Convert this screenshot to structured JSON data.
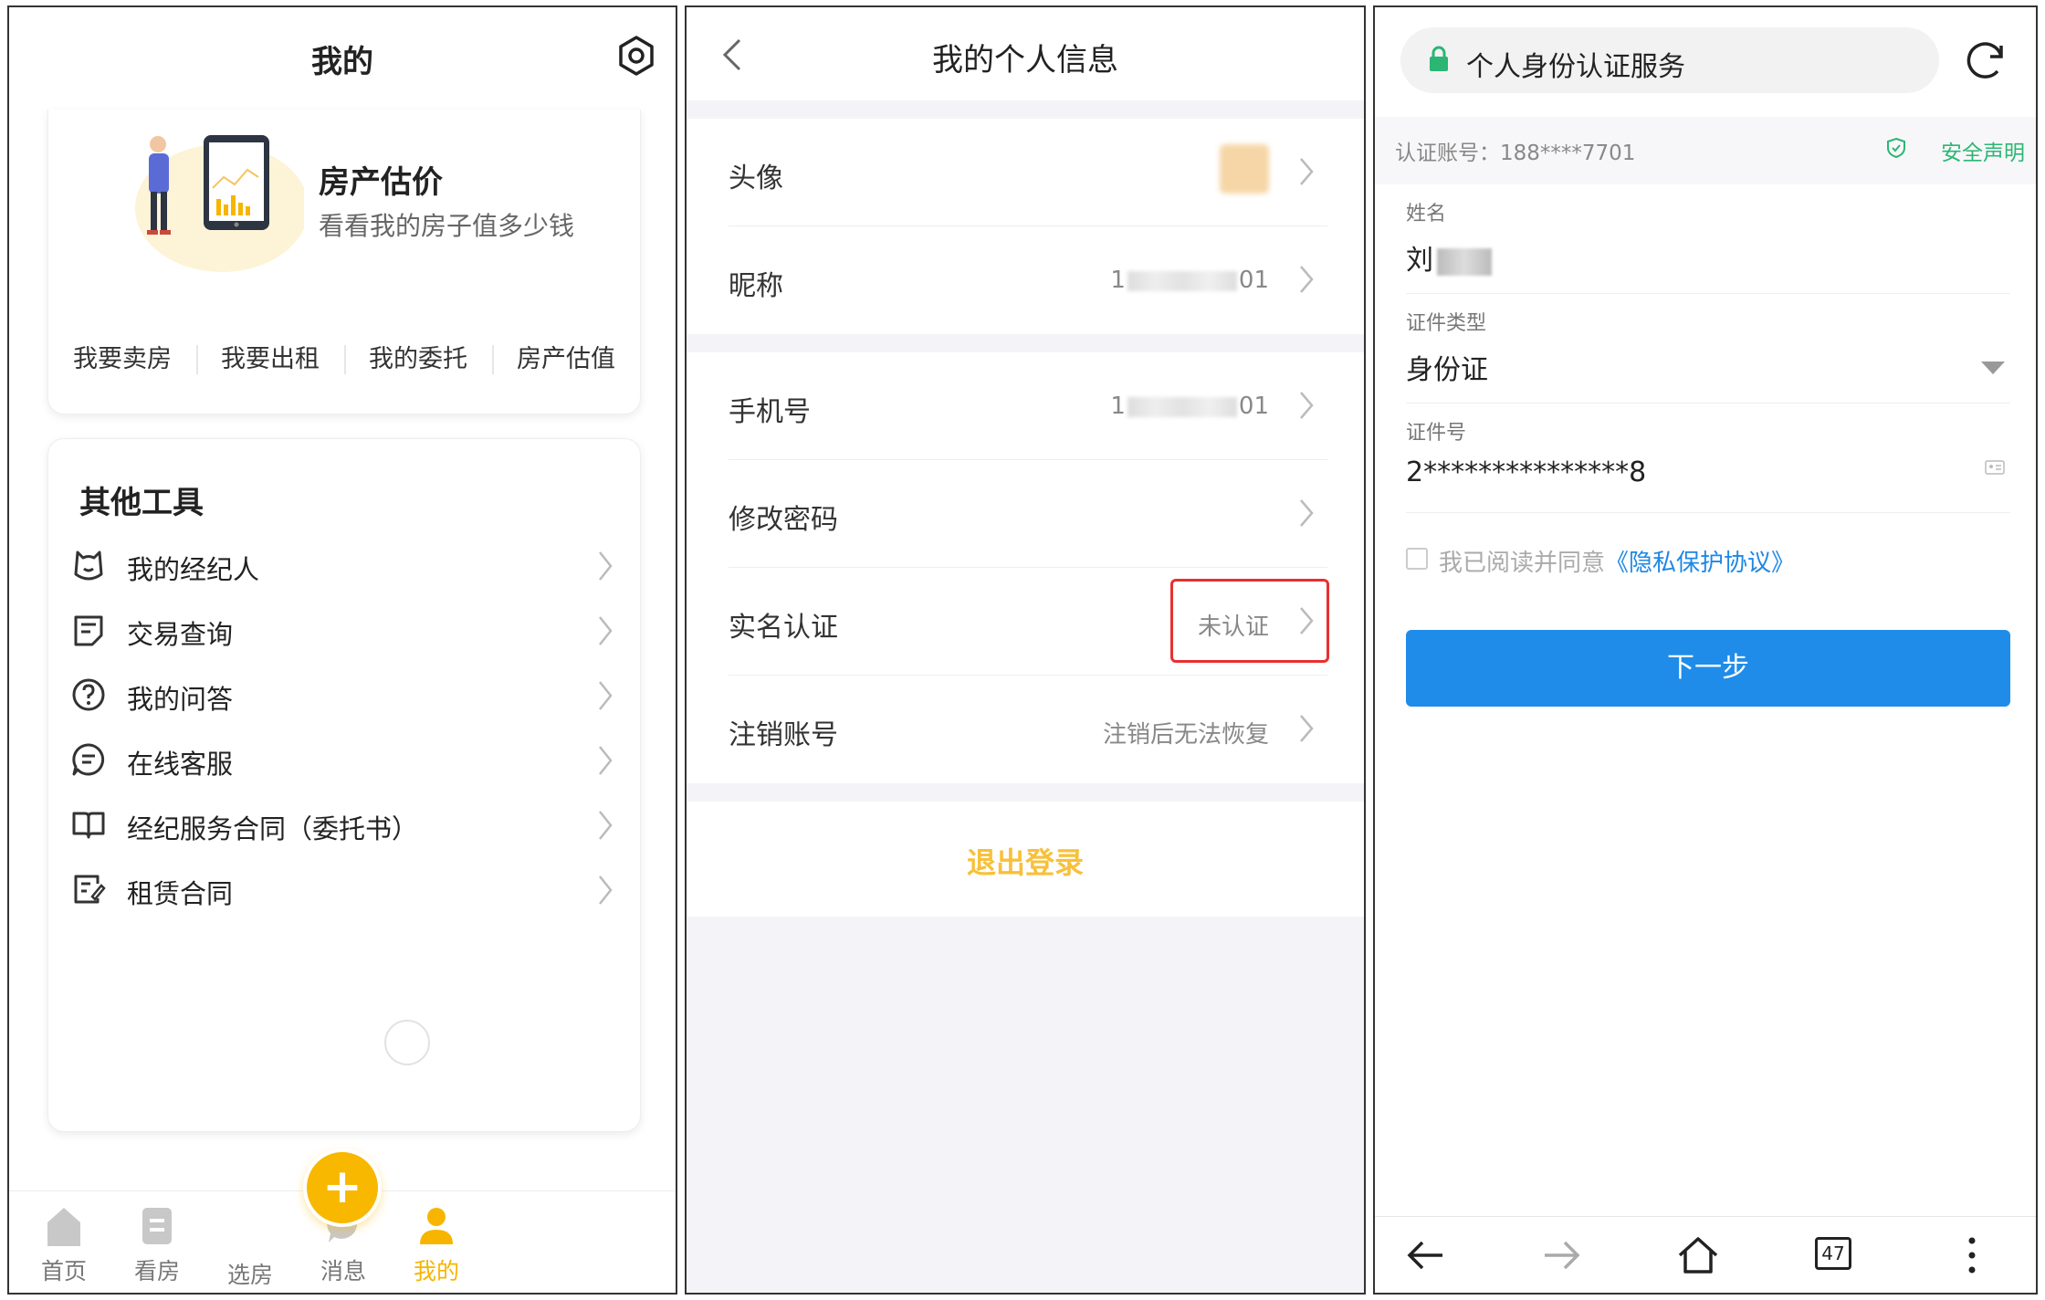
{
  "panel1": {
    "title": "我的",
    "promo": {
      "title": "房产估价",
      "subtitle": "看看我的房子值多少钱",
      "quick_links": [
        "我要卖房",
        "我要出租",
        "我的委托",
        "房产估值"
      ]
    },
    "tools": {
      "title": "其他工具",
      "items": [
        {
          "label": "我的经纪人",
          "icon": "agent-icon"
        },
        {
          "label": "交易查询",
          "icon": "transaction-icon"
        },
        {
          "label": "我的问答",
          "icon": "question-icon"
        },
        {
          "label": "在线客服",
          "icon": "chat-icon"
        },
        {
          "label": "经纪服务合同（委托书）",
          "icon": "book-icon"
        },
        {
          "label": "租赁合同",
          "icon": "contract-icon"
        }
      ]
    },
    "tabbar": {
      "items": [
        {
          "label": "首页",
          "icon": "home-icon"
        },
        {
          "label": "看房",
          "icon": "house-view-icon"
        },
        {
          "label": "选房",
          "icon": "plus-icon"
        },
        {
          "label": "消息",
          "icon": "message-icon"
        },
        {
          "label": "我的",
          "icon": "user-icon",
          "active": true
        }
      ]
    },
    "accent": "#F9B800"
  },
  "panel2": {
    "title": "我的个人信息",
    "rows": {
      "avatar": {
        "label": "头像"
      },
      "nickname": {
        "label": "昵称",
        "value_prefix": "1",
        "value_suffix": "01"
      },
      "phone": {
        "label": "手机号",
        "value_prefix": "1",
        "value_suffix": "01"
      },
      "password": {
        "label": "修改密码"
      },
      "realname": {
        "label": "实名认证",
        "value": "未认证"
      },
      "cancel": {
        "label": "注销账号",
        "value": "注销后无法恢复"
      }
    },
    "logout": "退出登录",
    "highlight_color": "#E8302F",
    "logout_color": "#F8C03A"
  },
  "panel3": {
    "url_title": "个人身份认证服务",
    "account_label": "认证账号：188****7701",
    "safety": "安全声明",
    "fields": {
      "name": {
        "label": "姓名",
        "value": "刘"
      },
      "id_type": {
        "label": "证件类型",
        "value": "身份证"
      },
      "id_no": {
        "label": "证件号",
        "value": "2***************8"
      }
    },
    "agree_text": "我已阅读并同意",
    "agree_link": "《隐私保护协议》",
    "next": "下一步",
    "tab_count": "47",
    "button_color": "#1F8CE9"
  }
}
